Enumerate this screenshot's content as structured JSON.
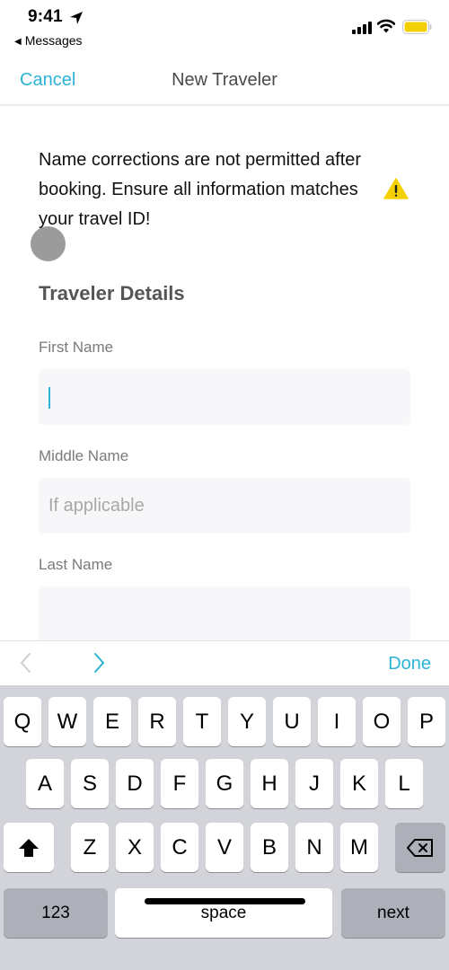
{
  "status_bar": {
    "time": "9:41",
    "back_app": "Messages",
    "icons": [
      "location-arrow-icon",
      "cellular-signal-icon",
      "wifi-icon",
      "battery-icon"
    ],
    "battery_color": "#f5d000"
  },
  "nav": {
    "cancel_label": "Cancel",
    "title": "New Traveler"
  },
  "notice": {
    "text": "Name corrections are not permitted after booking. Ensure all information matches your travel ID!",
    "icon": "warning-icon"
  },
  "form": {
    "section_title": "Traveler Details",
    "fields": [
      {
        "label": "First Name",
        "value": "",
        "placeholder": "",
        "focused": true
      },
      {
        "label": "Middle Name",
        "value": "",
        "placeholder": "If applicable",
        "focused": false
      },
      {
        "label": "Last Name",
        "value": "",
        "placeholder": "",
        "focused": false
      }
    ]
  },
  "accessory": {
    "prev_icon": "chevron-left-icon",
    "next_icon": "chevron-right-icon",
    "done_label": "Done"
  },
  "keyboard": {
    "row1": [
      "Q",
      "W",
      "E",
      "R",
      "T",
      "Y",
      "U",
      "I",
      "O",
      "P"
    ],
    "row2": [
      "A",
      "S",
      "D",
      "F",
      "G",
      "H",
      "J",
      "K",
      "L"
    ],
    "row3": [
      "Z",
      "X",
      "C",
      "V",
      "B",
      "N",
      "M"
    ],
    "numbers_label": "123",
    "space_label": "space",
    "return_label": "next"
  },
  "colors": {
    "accent": "#2bb4d6",
    "warning": "#f5d000"
  }
}
